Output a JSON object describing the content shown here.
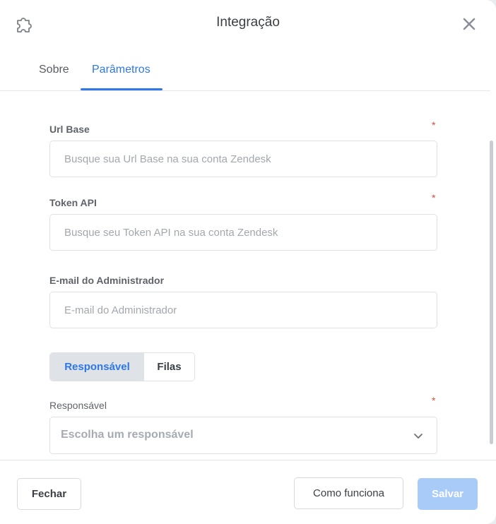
{
  "header": {
    "title": "Integração",
    "left_icon": "puzzle-icon",
    "close_icon": "close-icon"
  },
  "tabs": [
    {
      "label": "Sobre",
      "active": false
    },
    {
      "label": "Parâmetros",
      "active": true
    }
  ],
  "form": {
    "url_base": {
      "label": "Url Base",
      "required_mark": "*",
      "value": "",
      "placeholder": "Busque sua Url Base na sua conta Zendesk"
    },
    "token_api": {
      "label": "Token API",
      "required_mark": "*",
      "value": "",
      "placeholder": "Busque seu Token API na sua conta Zendesk"
    },
    "admin_email": {
      "label": "E-mail do Administrador",
      "value": "",
      "placeholder": "E-mail do Administrador"
    },
    "segment": {
      "options": [
        "Responsável",
        "Filas"
      ],
      "selected": "Responsável"
    },
    "responsavel": {
      "label": "Responsável",
      "required_mark": "*",
      "selected_text": "Escolha um responsável"
    }
  },
  "footer": {
    "close_label": "Fechar",
    "how_label": "Como funciona",
    "save_label": "Salvar"
  },
  "colors": {
    "accent": "#2d78e6",
    "save_disabled": "#a9cbf7",
    "required": "#e2483d"
  }
}
